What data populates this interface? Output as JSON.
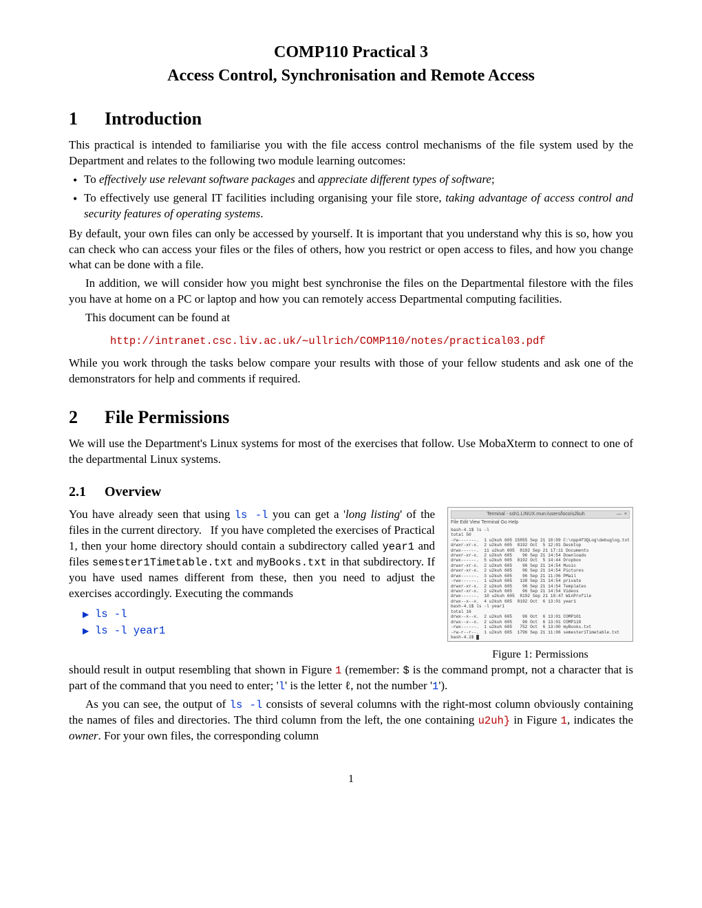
{
  "title": {
    "line1": "COMP110 Practical 3",
    "line2": "Access Control, Synchronisation and Remote Access"
  },
  "sec1": {
    "num": "1",
    "heading": "Introduction",
    "p1": "This practical is intended to familiarise you with the file access control mechanisms of the file system used by the Department and relates to the following two module learning outcomes:",
    "bul1a": "To ",
    "bul1b": "effectively use relevant software packages",
    "bul1c": " and ",
    "bul1d": "appreciate different types of software",
    "bul1e": ";",
    "bul2a": "To effectively use general IT facilities including organising your file store, ",
    "bul2b": "taking advantage of access control and security features of operating systems",
    "bul2c": ".",
    "p2": "By default, your own files can only be accessed by yourself. It is important that you understand why this is so, how you can check who can access your files or the files of others, how you restrict or open access to files, and how you change what can be done with a file.",
    "p3": "In addition, we will consider how you might best synchronise the files on the Departmental filestore with the files you have at home on a PC or laptop and how you can remotely access Departmental computing facilities.",
    "p4": "This document can be found at",
    "url_prefix": "http://intranet.csc.liv.ac.uk/",
    "url_tilde": "∼",
    "url_suffix": "ullrich/COMP110/notes/practical03.pdf",
    "p5": "While you work through the tasks below compare your results with those of your fellow students and ask one of the demonstrators for help and comments if required."
  },
  "sec2": {
    "num": "2",
    "heading": "File Permissions",
    "p1": "We will use the Department's Linux systems for most of the exercises that follow. Use MobaXterm to connect to one of the departmental Linux systems."
  },
  "sec21": {
    "num": "2.1",
    "heading": "Overview",
    "left_a": "You have already seen that using ",
    "ls_l": "ls -l",
    "left_b": " you can get a '",
    "long_listing": "long listing",
    "left_c1": "' of the files in the current directory.",
    "left_c2": "If you have completed the exercises of Practical 1, then your home directory should contain a subdirectory called ",
    "year1": "year1",
    "left_d": " and files ",
    "f1": "semester1Timetable.txt",
    "left_e": " and ",
    "f2": "myBooks.txt",
    "left_f": " in that subdirectory. If you have used names different from these, then you need to adjust the exercises accordingly. Executing the commands",
    "cmd1": "ls -l",
    "cmd2": "ls -l year1",
    "fig_titlebar": "Terminal - ssh1.LINUX.mun:/users/loco/u2kuh",
    "fig_menubar": "File  Edit  View  Terminal  Go  Help",
    "fig_lines": [
      "bash-4.1$ ls -l",
      "total 50",
      "-rw-------.  1 u2kuh 605 15855 Sep 21 10:09 C:\\npp4f3QLog\\debuglog.txt",
      "drwxr-xr-x.  2 u2kuh 605  8192 Oct  5 12:01 Desktop",
      "drwx------.  11 u2kuh 605  8192 Sep 21 17:11 Documents",
      "drwxr-xr-x.  2 u2kuh 605    96 Sep 21 14:54 Downloads",
      "drwx------.  5 u2kuh 605  8192 Oct  5 14:44 Dropbox",
      "drwxr-xr-x.  2 u2kuh 605    96 Sep 21 14:54 Music",
      "drwxr-xr-x.  2 u2kuh 605    96 Sep 21 14:54 Pictures",
      "drwx------.  3 u2kuh 605    96 Sep 21 11:06 PMail",
      "-rwx------.  1 u2kuh 605   138 Sep 21 14:54 private",
      "drwxr-xr-x.  2 u2kuh 605    96 Sep 21 14:54 Templates",
      "drwxr-xr-x.  2 u2kuh 605    96 Sep 21 14:54 Videos",
      "drwx------.  10 u2kuh 605  8192 Sep 21 10:47 WinProfile",
      "drwx--x--x.  4 u2kuh 605  8192 Oct  6 13:01 year1",
      "bash-4.1$ ls -l year1",
      "total 16",
      "drwx--x--x.  2 u2kuh 605    96 Oct  6 13:01 COMP101",
      "drwx--x--x.  2 u2kuh 605    96 Oct  6 13:01 COMP110",
      "-rwx------.  1 u2kuh 605   752 Oct  6 13:00 myBooks.txt",
      "-rw-r--r--.  1 u2kuh 605  1796 Sep 21 11:06 semester1Timetable.txt",
      "bash-4.1$ █"
    ],
    "figcap_a": "Figure 1: Permissions",
    "p_after_a": "should result in output resembling that shown in Figure ",
    "figref1": "1",
    "p_after_b": " (remember: ",
    "dollar": "$",
    "p_after_c": " is the command prompt, not a character that is part of the command that you need to enter; '",
    "letter_l": "l",
    "p_after_d": "' is the letter ℓ, not the number '",
    "num1": "1",
    "p_after_e": "').",
    "p_last_a": "As you can see, the output of ",
    "p_last_b": " consists of several columns with the right-most column obviously containing the names of files and directories. The third column from the left, the one containing ",
    "u2uh": "u2uh}",
    "p_last_c": " in Figure ",
    "p_last_d": ", indicates the ",
    "owner": "owner",
    "p_last_e": ". For your own files, the corresponding column"
  },
  "pagenum": "1"
}
